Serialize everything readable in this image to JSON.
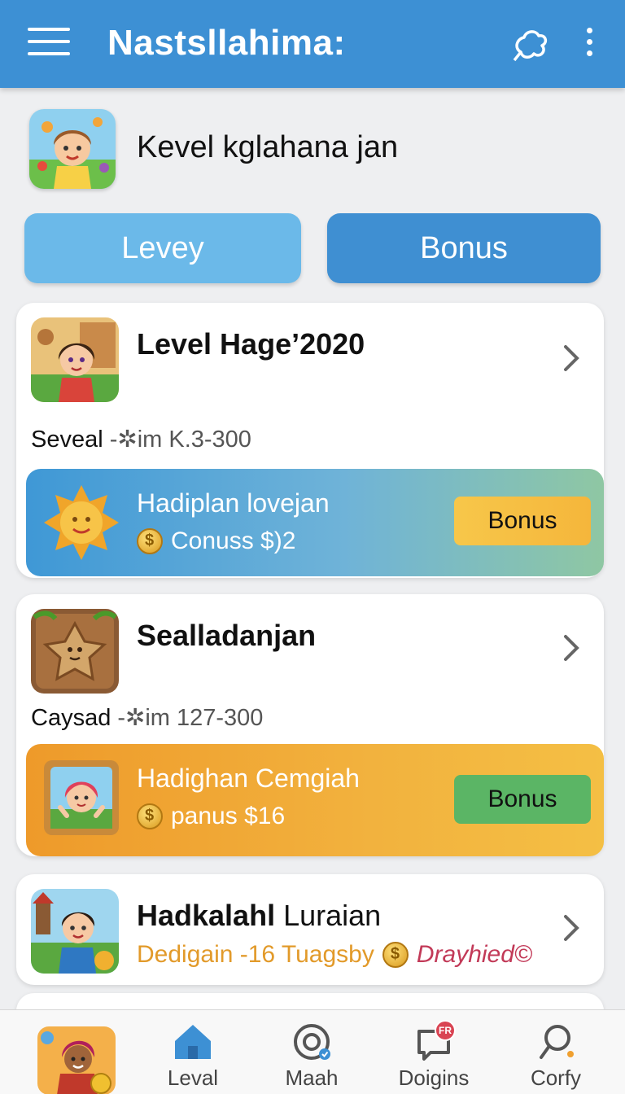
{
  "appbar": {
    "title": "Nastsllahima:"
  },
  "header": {
    "title": "Kevel kglahana jan"
  },
  "tabs": [
    {
      "label": "Levey"
    },
    {
      "label": "Bonus"
    }
  ],
  "cards": [
    {
      "title": "Level Hage’2020",
      "sub_label": "Seveal",
      "sub_detail": "-✲im K.3-300",
      "promo": {
        "title": "Hadiplan lovejan",
        "subtitle": "Conuss $)2",
        "button": "Bonus"
      }
    },
    {
      "title": "Sealladanjan",
      "sub_label": "Caysad",
      "sub_detail": "-✲im 127-300",
      "promo": {
        "title": "Hadighan Cemgiah",
        "subtitle": "panus $16",
        "button": "Bonus"
      }
    },
    {
      "title_bold": "Hadkalahl",
      "title_light": "Luraian",
      "sub_orange": "Dedigain -16 Tuagsby",
      "sub_pink": "Drayhied©"
    }
  ],
  "bottom_nav": {
    "items": [
      {
        "label": "Leval",
        "icon": "home-icon"
      },
      {
        "label": "Maah",
        "icon": "at-icon"
      },
      {
        "label": "Doigins",
        "icon": "chat-icon",
        "badge": "FR"
      },
      {
        "label": "Corfy",
        "icon": "search-icon"
      }
    ]
  },
  "colors": {
    "primary": "#3d90d4",
    "accent_orange": "#f2b23e",
    "accent_green": "#5bb565"
  }
}
